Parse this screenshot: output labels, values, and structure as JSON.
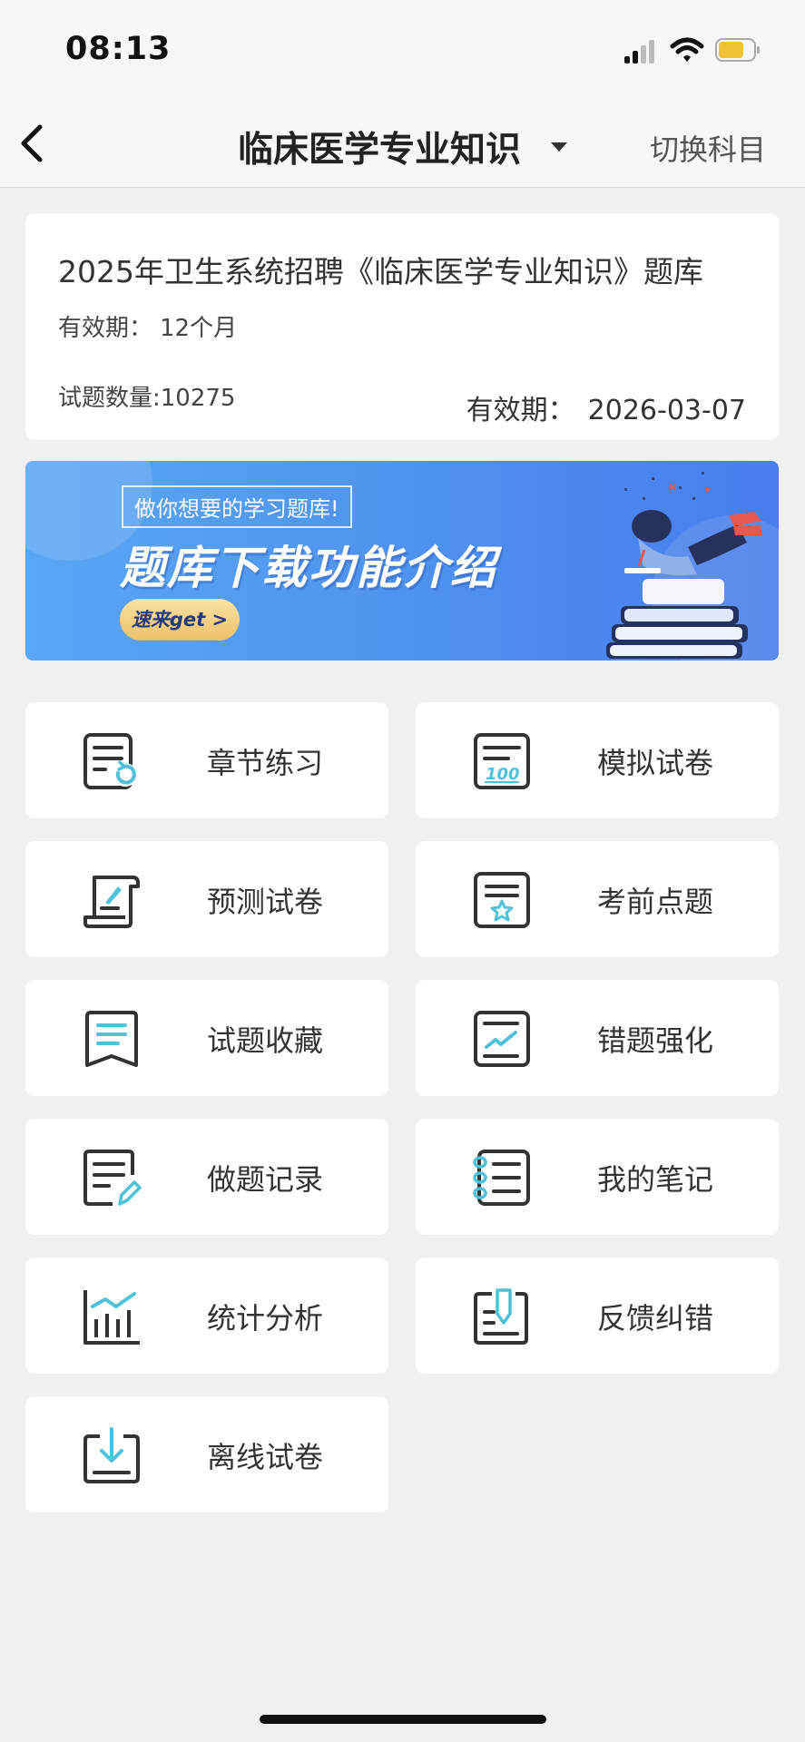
{
  "status_bar": {
    "time": "08:13"
  },
  "nav": {
    "title": "临床医学专业知识",
    "switch_label": "切换科目"
  },
  "info": {
    "title": "2025年卫生系统招聘《临床医学专业知识》题库",
    "validity_label": "有效期：",
    "validity_term": "12个月",
    "question_count": "试题数量:10275",
    "expiry_label": "有效期：",
    "expiry_date": "2026-03-07"
  },
  "banner": {
    "tag": "做你想要的学习题库!",
    "headline": "题库下载功能介绍",
    "cta": "速来get >"
  },
  "menu": [
    {
      "label": "章节练习",
      "icon": "chapter-practice-icon"
    },
    {
      "label": "模拟试卷",
      "icon": "mock-exam-icon"
    },
    {
      "label": "预测试卷",
      "icon": "prediction-paper-icon"
    },
    {
      "label": "考前点题",
      "icon": "key-points-star-icon"
    },
    {
      "label": "试题收藏",
      "icon": "bookmark-icon"
    },
    {
      "label": "错题强化",
      "icon": "mistakes-chart-icon"
    },
    {
      "label": "做题记录",
      "icon": "record-pencil-icon"
    },
    {
      "label": "我的笔记",
      "icon": "notebook-icon"
    },
    {
      "label": "统计分析",
      "icon": "statistics-icon"
    },
    {
      "label": "反馈纠错",
      "icon": "feedback-icon"
    },
    {
      "label": "离线试卷",
      "icon": "offline-download-icon"
    }
  ],
  "colors": {
    "accent": "#4fc1d8",
    "icon_stroke": "#333333",
    "background": "#f0f0f0"
  }
}
